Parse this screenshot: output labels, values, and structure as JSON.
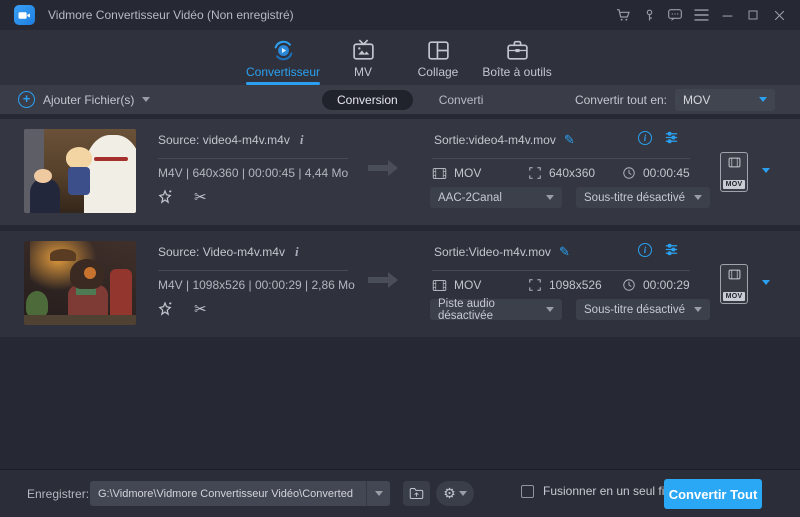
{
  "window": {
    "title": "Vidmore Convertisseur Vidéo (Non enregistré)"
  },
  "nav": {
    "tabs": [
      {
        "label": "Convertisseur",
        "active": true
      },
      {
        "label": "MV",
        "active": false
      },
      {
        "label": "Collage",
        "active": false
      },
      {
        "label": "Boîte à outils",
        "active": false
      }
    ]
  },
  "toolbar": {
    "add_files": "Ajouter Fichier(s)",
    "toggle_conversion": "Conversion",
    "toggle_converted": "Converti",
    "convert_all_label": "Convertir tout en:",
    "convert_all_value": "MOV"
  },
  "files": [
    {
      "source_label": "Source: video4-m4v.m4v",
      "meta": "M4V | 640x360 | 00:00:45 | 4,44 Mo",
      "output_label": "Sortie:video4-m4v.mov",
      "out_format": "MOV",
      "out_resolution": "640x360",
      "out_duration": "00:00:45",
      "audio_dropdown": "AAC-2Canal",
      "subtitle_dropdown": "Sous-titre désactivé",
      "badge": "MOV"
    },
    {
      "source_label": "Source: Video-m4v.m4v",
      "meta": "M4V | 1098x526 | 00:00:29 | 2,86 Mo",
      "output_label": "Sortie:Video-m4v.mov",
      "out_format": "MOV",
      "out_resolution": "1098x526",
      "out_duration": "00:00:29",
      "audio_dropdown": "Piste audio désactivée",
      "subtitle_dropdown": "Sous-titre désactivé",
      "badge": "MOV"
    }
  ],
  "footer": {
    "save_label": "Enregistrer:",
    "save_path": "G:\\Vidmore\\Vidmore Convertisseur Vidéo\\Converted",
    "merge_label": "Fusionner en un seul fichier",
    "convert_button": "Convertir Tout"
  },
  "icons": {
    "plus": "+",
    "info_italic": "i",
    "info_circle": "i",
    "pencil": "✎",
    "scissors": "✂",
    "gear": "⚙"
  },
  "colors": {
    "accent_blue": "#2ba0f0",
    "convert_button_blue": "#2aa7f5",
    "titlebar_bg": "#262834",
    "tabbar_bg": "#2f323d",
    "toolbar_bg": "#3a3d48",
    "row1_bg": "#343741",
    "row2_bg": "#2f323c",
    "footer_bg": "#2b2e38",
    "text_light": "#c2c5cd"
  }
}
